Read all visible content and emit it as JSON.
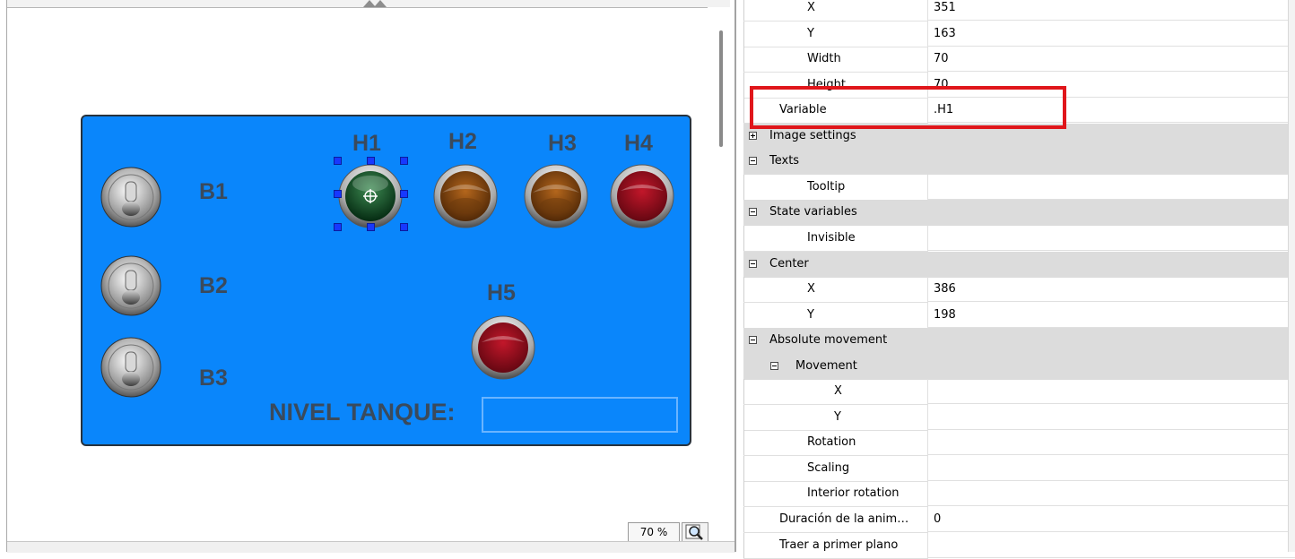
{
  "editor": {
    "zoom": "70 %",
    "icons": {
      "zoom": "zoom-magnifier-icon",
      "grip": "splitter-grip-icon"
    }
  },
  "hmi": {
    "panel_color": "#0a86fb",
    "switches": [
      {
        "label": "B1",
        "state": "off"
      },
      {
        "label": "B2",
        "state": "off"
      },
      {
        "label": "B3",
        "state": "off"
      }
    ],
    "lamps": [
      {
        "label": "H1",
        "color": "green",
        "selected": true
      },
      {
        "label": "H2",
        "color": "amber"
      },
      {
        "label": "H3",
        "color": "amber"
      },
      {
        "label": "H4",
        "color": "red"
      },
      {
        "label": "H5",
        "color": "red"
      }
    ],
    "level_label": "NIVEL TANQUE:",
    "level_value": ""
  },
  "properties": {
    "rows": [
      {
        "type": "prop",
        "indent": 2,
        "name": "X",
        "value": "351"
      },
      {
        "type": "prop",
        "indent": 2,
        "name": "Y",
        "value": "163"
      },
      {
        "type": "prop",
        "indent": 2,
        "name": "Width",
        "value": "70"
      },
      {
        "type": "prop",
        "indent": 2,
        "name": "Height",
        "value": "70"
      },
      {
        "type": "prop",
        "indent": 1,
        "name": "Variable",
        "value": ".H1"
      },
      {
        "type": "cat",
        "indent": 0,
        "name": "Image settings",
        "expanded": false
      },
      {
        "type": "cat",
        "indent": 0,
        "name": "Texts",
        "expanded": true
      },
      {
        "type": "prop",
        "indent": 2,
        "name": "Tooltip",
        "value": ""
      },
      {
        "type": "cat",
        "indent": 0,
        "name": "State variables",
        "expanded": true
      },
      {
        "type": "prop",
        "indent": 2,
        "name": "Invisible",
        "value": ""
      },
      {
        "type": "cat",
        "indent": 0,
        "name": "Center",
        "expanded": true
      },
      {
        "type": "prop",
        "indent": 2,
        "name": "X",
        "value": "386"
      },
      {
        "type": "prop",
        "indent": 2,
        "name": "Y",
        "value": "198"
      },
      {
        "type": "cat",
        "indent": 0,
        "name": "Absolute movement",
        "expanded": true
      },
      {
        "type": "cat",
        "indent": 1,
        "name": "Movement",
        "expanded": true
      },
      {
        "type": "prop",
        "indent": 3,
        "name": "X",
        "value": ""
      },
      {
        "type": "prop",
        "indent": 3,
        "name": "Y",
        "value": ""
      },
      {
        "type": "prop",
        "indent": 2,
        "name": "Rotation",
        "value": ""
      },
      {
        "type": "prop",
        "indent": 2,
        "name": "Scaling",
        "value": ""
      },
      {
        "type": "prop",
        "indent": 2,
        "name": "Interior rotation",
        "value": ""
      },
      {
        "type": "prop",
        "indent": 1,
        "name": "Duración de la anim…",
        "value": "0"
      },
      {
        "type": "prop",
        "indent": 1,
        "name": "Traer a primer plano",
        "value": ""
      }
    ],
    "highlight_color": "#e0161b"
  }
}
